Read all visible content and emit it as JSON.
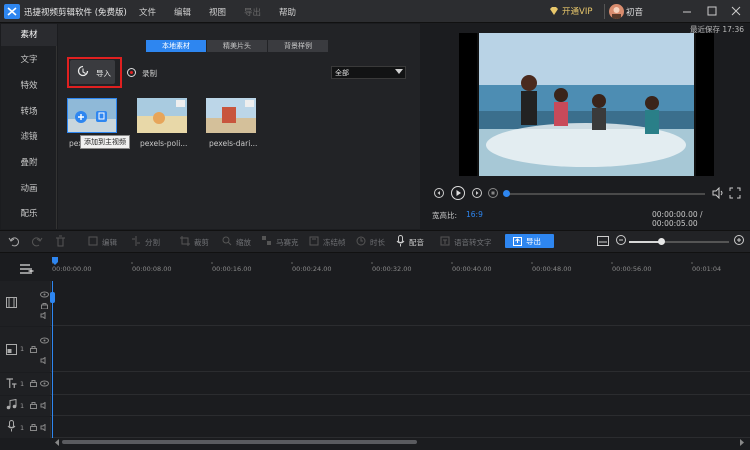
{
  "titlebar": {
    "app_title": "迅捷视频剪辑软件 (免费版)",
    "menu": [
      "文件",
      "编辑",
      "视图",
      "导出",
      "帮助"
    ],
    "vip_label": "开通VIP",
    "user_name": "初音"
  },
  "left_nav": {
    "items": [
      "素材",
      "文字",
      "特效",
      "转场",
      "滤镜",
      "叠附",
      "动画",
      "配乐"
    ],
    "active_index": 0
  },
  "media": {
    "tabs": [
      "本地素材",
      "精美片头",
      "背景样例"
    ],
    "active_tab": 0,
    "import_label": "导入",
    "record_label": "录制",
    "filter_value": "全部",
    "tooltip": "添加到主视频",
    "items": [
      {
        "label": "pex"
      },
      {
        "label": "pexels-poli..."
      },
      {
        "label": "pexels-dari..."
      }
    ]
  },
  "preview": {
    "autosave": "最近保存 17:36",
    "aspect_label": "宽高比:",
    "aspect_value": "16:9",
    "timecode": "00:00:00.00 / 00:00:05.00",
    "progress": 0
  },
  "toolbar": {
    "tools": [
      "编辑",
      "分割",
      "裁剪",
      "缩放",
      "马赛克",
      "冻结帧",
      "时长",
      "配音",
      "语音转文字"
    ],
    "export_label": "导出",
    "zoom_level": 0.33
  },
  "timeline": {
    "ticks": [
      "00:00:00.00",
      "00:00:08.00",
      "00:00:16.00",
      "00:00:24.00",
      "00:00:32.00",
      "00:00:40.00",
      "00:00:48.00",
      "00:00:56.00",
      "00:01:04"
    ],
    "track_numbers": [
      "1",
      "1",
      "1",
      "1"
    ]
  },
  "colors": {
    "accent": "#2e86f0",
    "highlight_border": "#e02020",
    "vip": "#e8c76b"
  }
}
